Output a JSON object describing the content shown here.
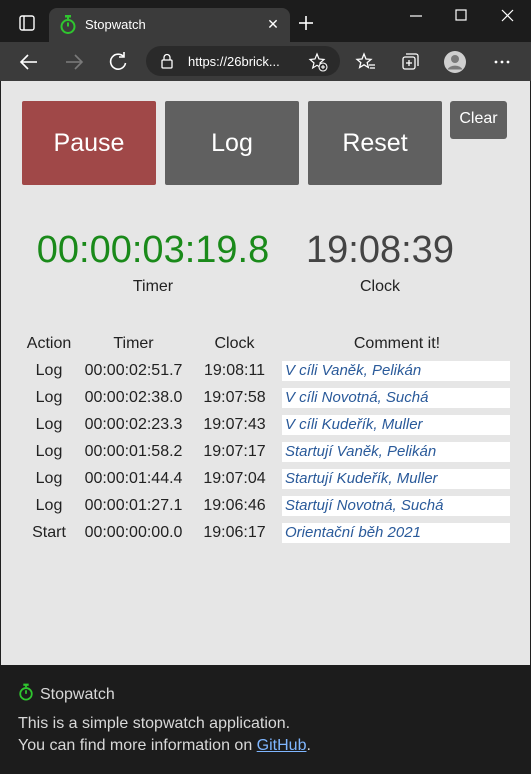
{
  "browser": {
    "tab_title": "Stopwatch",
    "url": "https://26brick...",
    "accent": "#2fc62f"
  },
  "controls": {
    "pause_label": "Pause",
    "log_label": "Log",
    "reset_label": "Reset",
    "clear_label": "Clear"
  },
  "timer": {
    "value": "00:00:03:19.8",
    "label": "Timer",
    "color": "#1a8a1a"
  },
  "clock": {
    "value": "19:08:39",
    "label": "Clock"
  },
  "log_table": {
    "headers": [
      "Action",
      "Timer",
      "Clock",
      "Comment it!"
    ],
    "rows": [
      {
        "action": "Log",
        "timer": "00:00:02:51.7",
        "clock": "19:08:11",
        "comment": "V cíli Vaněk, Pelikán"
      },
      {
        "action": "Log",
        "timer": "00:00:02:38.0",
        "clock": "19:07:58",
        "comment": "V cíli Novotná, Suchá"
      },
      {
        "action": "Log",
        "timer": "00:00:02:23.3",
        "clock": "19:07:43",
        "comment": "V cíli Kudeřík, Muller"
      },
      {
        "action": "Log",
        "timer": "00:00:01:58.2",
        "clock": "19:07:17",
        "comment": "Startují Vaněk, Pelikán"
      },
      {
        "action": "Log",
        "timer": "00:00:01:44.4",
        "clock": "19:07:04",
        "comment": "Startují Kudeřík, Muller"
      },
      {
        "action": "Log",
        "timer": "00:00:01:27.1",
        "clock": "19:06:46",
        "comment": "Startují Novotná, Suchá"
      },
      {
        "action": "Start",
        "timer": "00:00:00:00.0",
        "clock": "19:06:17",
        "comment": "Orientační běh 2021"
      }
    ]
  },
  "footer": {
    "title": "Stopwatch",
    "line1": "This is a simple stopwatch application.",
    "line2_prefix": "You can find more information on ",
    "link_text": "GitHub",
    "line2_suffix": "."
  }
}
